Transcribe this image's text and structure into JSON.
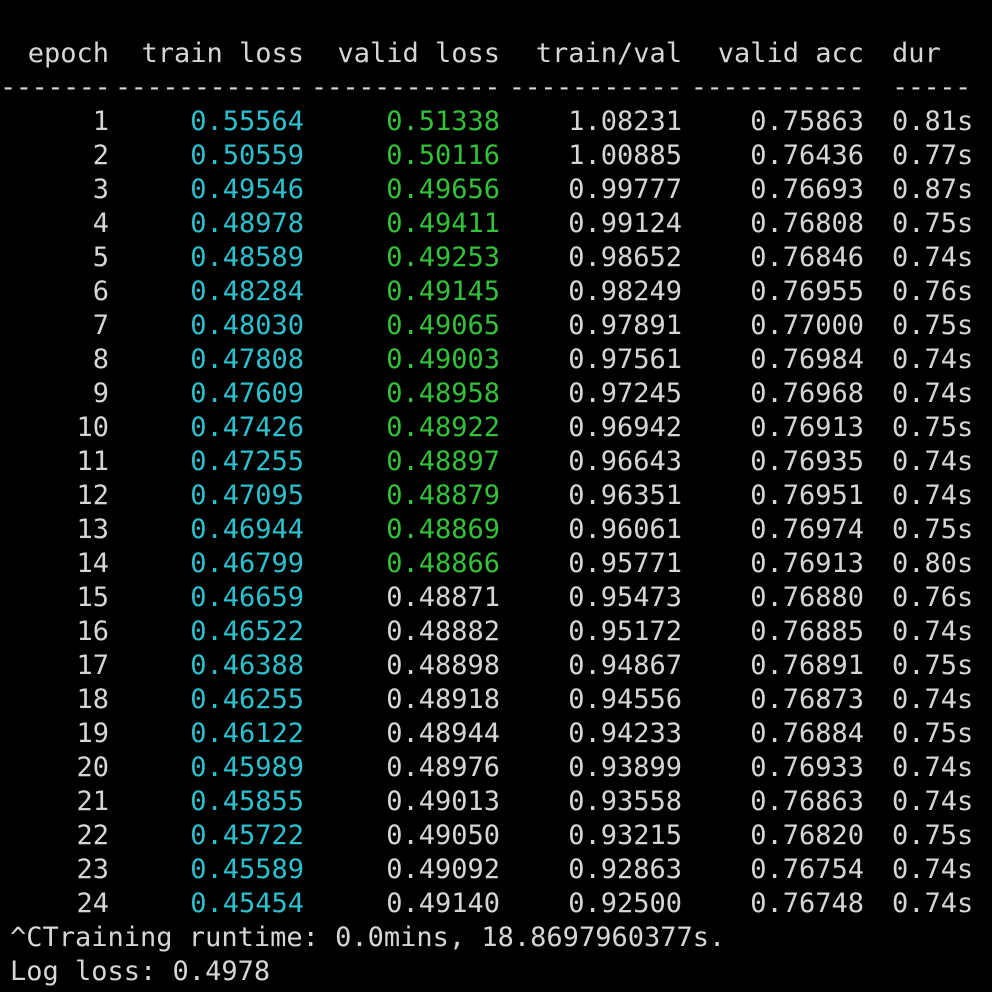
{
  "colors": {
    "background": "#000000",
    "text": "#d6d6d6",
    "train_loss": "#2bc1cf",
    "valid_loss_best": "#33c13a"
  },
  "header": {
    "epoch": "epoch",
    "train_loss": "train loss",
    "valid_loss": "valid loss",
    "train_val": "train/val",
    "valid_acc": "valid acc",
    "dur": "dur"
  },
  "separator": {
    "epoch": "-------",
    "train_loss": "------------",
    "valid_loss": "------------",
    "train_val": "-----------",
    "valid_acc": "-----------",
    "dur": "-----"
  },
  "rows": [
    {
      "epoch": "1",
      "train_loss": "0.55564",
      "valid_loss": "0.51338",
      "valid_best": true,
      "train_val": "1.08231",
      "valid_acc": "0.75863",
      "dur": "0.81s"
    },
    {
      "epoch": "2",
      "train_loss": "0.50559",
      "valid_loss": "0.50116",
      "valid_best": true,
      "train_val": "1.00885",
      "valid_acc": "0.76436",
      "dur": "0.77s"
    },
    {
      "epoch": "3",
      "train_loss": "0.49546",
      "valid_loss": "0.49656",
      "valid_best": true,
      "train_val": "0.99777",
      "valid_acc": "0.76693",
      "dur": "0.87s"
    },
    {
      "epoch": "4",
      "train_loss": "0.48978",
      "valid_loss": "0.49411",
      "valid_best": true,
      "train_val": "0.99124",
      "valid_acc": "0.76808",
      "dur": "0.75s"
    },
    {
      "epoch": "5",
      "train_loss": "0.48589",
      "valid_loss": "0.49253",
      "valid_best": true,
      "train_val": "0.98652",
      "valid_acc": "0.76846",
      "dur": "0.74s"
    },
    {
      "epoch": "6",
      "train_loss": "0.48284",
      "valid_loss": "0.49145",
      "valid_best": true,
      "train_val": "0.98249",
      "valid_acc": "0.76955",
      "dur": "0.76s"
    },
    {
      "epoch": "7",
      "train_loss": "0.48030",
      "valid_loss": "0.49065",
      "valid_best": true,
      "train_val": "0.97891",
      "valid_acc": "0.77000",
      "dur": "0.75s"
    },
    {
      "epoch": "8",
      "train_loss": "0.47808",
      "valid_loss": "0.49003",
      "valid_best": true,
      "train_val": "0.97561",
      "valid_acc": "0.76984",
      "dur": "0.74s"
    },
    {
      "epoch": "9",
      "train_loss": "0.47609",
      "valid_loss": "0.48958",
      "valid_best": true,
      "train_val": "0.97245",
      "valid_acc": "0.76968",
      "dur": "0.74s"
    },
    {
      "epoch": "10",
      "train_loss": "0.47426",
      "valid_loss": "0.48922",
      "valid_best": true,
      "train_val": "0.96942",
      "valid_acc": "0.76913",
      "dur": "0.75s"
    },
    {
      "epoch": "11",
      "train_loss": "0.47255",
      "valid_loss": "0.48897",
      "valid_best": true,
      "train_val": "0.96643",
      "valid_acc": "0.76935",
      "dur": "0.74s"
    },
    {
      "epoch": "12",
      "train_loss": "0.47095",
      "valid_loss": "0.48879",
      "valid_best": true,
      "train_val": "0.96351",
      "valid_acc": "0.76951",
      "dur": "0.74s"
    },
    {
      "epoch": "13",
      "train_loss": "0.46944",
      "valid_loss": "0.48869",
      "valid_best": true,
      "train_val": "0.96061",
      "valid_acc": "0.76974",
      "dur": "0.75s"
    },
    {
      "epoch": "14",
      "train_loss": "0.46799",
      "valid_loss": "0.48866",
      "valid_best": true,
      "train_val": "0.95771",
      "valid_acc": "0.76913",
      "dur": "0.80s"
    },
    {
      "epoch": "15",
      "train_loss": "0.46659",
      "valid_loss": "0.48871",
      "valid_best": false,
      "train_val": "0.95473",
      "valid_acc": "0.76880",
      "dur": "0.76s"
    },
    {
      "epoch": "16",
      "train_loss": "0.46522",
      "valid_loss": "0.48882",
      "valid_best": false,
      "train_val": "0.95172",
      "valid_acc": "0.76885",
      "dur": "0.74s"
    },
    {
      "epoch": "17",
      "train_loss": "0.46388",
      "valid_loss": "0.48898",
      "valid_best": false,
      "train_val": "0.94867",
      "valid_acc": "0.76891",
      "dur": "0.75s"
    },
    {
      "epoch": "18",
      "train_loss": "0.46255",
      "valid_loss": "0.48918",
      "valid_best": false,
      "train_val": "0.94556",
      "valid_acc": "0.76873",
      "dur": "0.74s"
    },
    {
      "epoch": "19",
      "train_loss": "0.46122",
      "valid_loss": "0.48944",
      "valid_best": false,
      "train_val": "0.94233",
      "valid_acc": "0.76884",
      "dur": "0.75s"
    },
    {
      "epoch": "20",
      "train_loss": "0.45989",
      "valid_loss": "0.48976",
      "valid_best": false,
      "train_val": "0.93899",
      "valid_acc": "0.76933",
      "dur": "0.74s"
    },
    {
      "epoch": "21",
      "train_loss": "0.45855",
      "valid_loss": "0.49013",
      "valid_best": false,
      "train_val": "0.93558",
      "valid_acc": "0.76863",
      "dur": "0.74s"
    },
    {
      "epoch": "22",
      "train_loss": "0.45722",
      "valid_loss": "0.49050",
      "valid_best": false,
      "train_val": "0.93215",
      "valid_acc": "0.76820",
      "dur": "0.75s"
    },
    {
      "epoch": "23",
      "train_loss": "0.45589",
      "valid_loss": "0.49092",
      "valid_best": false,
      "train_val": "0.92863",
      "valid_acc": "0.76754",
      "dur": "0.74s"
    },
    {
      "epoch": "24",
      "train_loss": "0.45454",
      "valid_loss": "0.49140",
      "valid_best": false,
      "train_val": "0.92500",
      "valid_acc": "0.76748",
      "dur": "0.74s"
    }
  ],
  "footer": {
    "runtime_line": "^CTraining runtime: 0.0mins, 18.8697960377s.",
    "logloss_line": "Log loss: 0.4978"
  }
}
